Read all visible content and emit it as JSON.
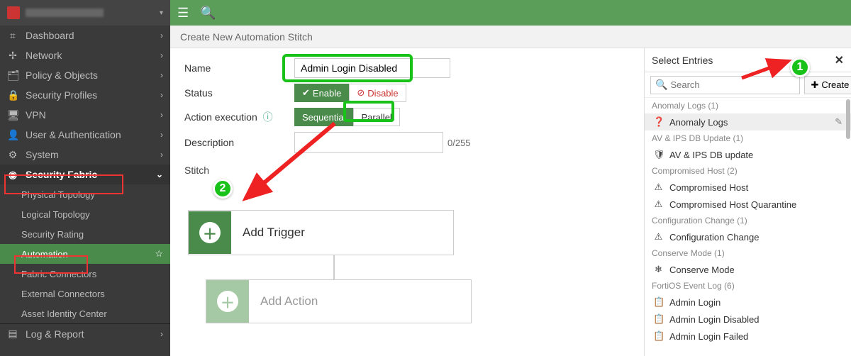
{
  "header": {
    "breadcrumb": "Create New Automation Stitch"
  },
  "sidebar": {
    "items": [
      {
        "icon": "⌗",
        "label": "Dashboard",
        "expandable": true
      },
      {
        "icon": "✢",
        "label": "Network",
        "expandable": true
      },
      {
        "icon": "🗂",
        "label": "Policy & Objects",
        "expandable": true
      },
      {
        "icon": "🔒",
        "label": "Security Profiles",
        "expandable": true
      },
      {
        "icon": "🖥",
        "label": "VPN",
        "expandable": true
      },
      {
        "icon": "👤",
        "label": "User & Authentication",
        "expandable": true
      },
      {
        "icon": "⚙",
        "label": "System",
        "expandable": true
      },
      {
        "icon": "◉",
        "label": "Security Fabric",
        "expandable": true,
        "open": true
      }
    ],
    "fabric_children": [
      "Physical Topology",
      "Logical Topology",
      "Security Rating",
      "Automation",
      "Fabric Connectors",
      "External Connectors",
      "Asset Identity Center"
    ],
    "last_cut": "Log & Report"
  },
  "form": {
    "name_label": "Name",
    "name_value": "Admin Login Disabled",
    "status_label": "Status",
    "enable": "Enable",
    "disable": "Disable",
    "action_exec_label": "Action execution",
    "sequential": "Sequential",
    "parallel": "Parallel",
    "description_label": "Description",
    "desc_count": "0/255",
    "stitch_label": "Stitch",
    "add_trigger": "Add Trigger",
    "add_action": "Add Action"
  },
  "panel": {
    "title": "Select Entries",
    "search_placeholder": "Search",
    "create_label": "Create",
    "groups": [
      {
        "header": "Anomaly Logs (1)",
        "items": [
          {
            "icon": "❓",
            "label": "Anomaly Logs",
            "editable": true,
            "selected": true
          }
        ]
      },
      {
        "header": "AV & IPS DB Update (1)",
        "items": [
          {
            "icon": "🛡",
            "label": "AV & IPS DB update"
          }
        ]
      },
      {
        "header": "Compromised Host (2)",
        "items": [
          {
            "icon": "⚠",
            "label": "Compromised Host"
          },
          {
            "icon": "⚠",
            "label": "Compromised Host Quarantine"
          }
        ]
      },
      {
        "header": "Configuration Change (1)",
        "items": [
          {
            "icon": "⚠",
            "label": "Configuration Change"
          }
        ]
      },
      {
        "header": "Conserve Mode (1)",
        "items": [
          {
            "icon": "❄",
            "label": "Conserve Mode"
          }
        ]
      },
      {
        "header": "FortiOS Event Log (6)",
        "items": [
          {
            "icon": "📋",
            "label": "Admin Login"
          },
          {
            "icon": "📋",
            "label": "Admin Login Disabled"
          },
          {
            "icon": "📋",
            "label": "Admin Login Failed"
          }
        ]
      }
    ]
  },
  "annotations": {
    "c1": "1",
    "c2": "2"
  }
}
